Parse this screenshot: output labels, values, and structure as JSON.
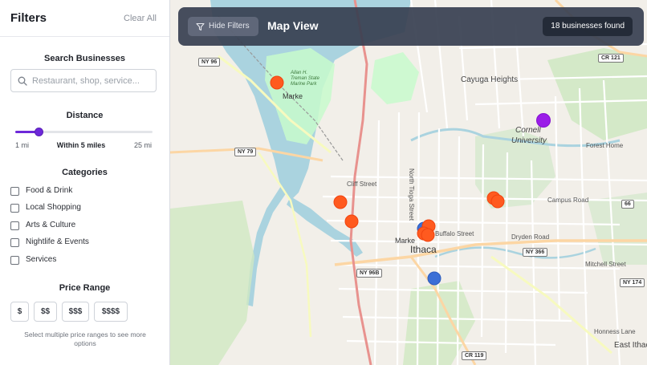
{
  "sidebar": {
    "title": "Filters",
    "clear_all": "Clear All",
    "search": {
      "label": "Search Businesses",
      "placeholder": "Restaurant, shop, service..."
    },
    "distance": {
      "label": "Distance",
      "min_label": "1 mi",
      "current_label": "Within 5 miles",
      "max_label": "25 mi",
      "value_fraction": 0.167
    },
    "categories": {
      "label": "Categories",
      "items": [
        {
          "label": "Food & Drink",
          "checked": false
        },
        {
          "label": "Local Shopping",
          "checked": false
        },
        {
          "label": "Arts & Culture",
          "checked": false
        },
        {
          "label": "Nightlife & Events",
          "checked": false
        },
        {
          "label": "Services",
          "checked": false
        }
      ]
    },
    "price": {
      "label": "Price Range",
      "options": [
        "$",
        "$$",
        "$$$",
        "$$$$"
      ],
      "note": "Select multiple price ranges to see more options"
    }
  },
  "map_bar": {
    "hide_filters": "Hide Filters",
    "title": "Map View",
    "count": "18 businesses found"
  },
  "map": {
    "labels": {
      "cayuga_heights": "Cayuga Heights",
      "cornell": "Cornell",
      "university": "University",
      "ithaca": "Ithaca",
      "east_ithaca": "East Ithaca",
      "forest_home": "Forest Home",
      "campus_road": "Campus Road",
      "dryden_road": "Dryden Road",
      "mitchell_street": "Mitchell Street",
      "honness_lane": "Honness Lane",
      "cliff_street": "Cliff Street",
      "buffalo_street": "Buffalo Street",
      "north_tioga": "North Tioga Street",
      "marker_a": "Marke",
      "marker_b": "Marke",
      "allan_treman": "Allan H. Treman State Marine Park"
    },
    "shields": {
      "ny96": "NY 96",
      "ny79": "NY 79",
      "ny96b": "NY 96B",
      "ny366": "NY 366",
      "cr121": "CR 121",
      "cr119": "CR 119",
      "ny174": "NY 174",
      "r66": "66"
    },
    "colors": {
      "food_marker": "#ff5a1f",
      "shopping_marker": "#3b6fd6",
      "arts_marker": "#9b1de8",
      "water": "#aad3df",
      "park": "#c8facc",
      "land": "#f2efe9"
    }
  }
}
